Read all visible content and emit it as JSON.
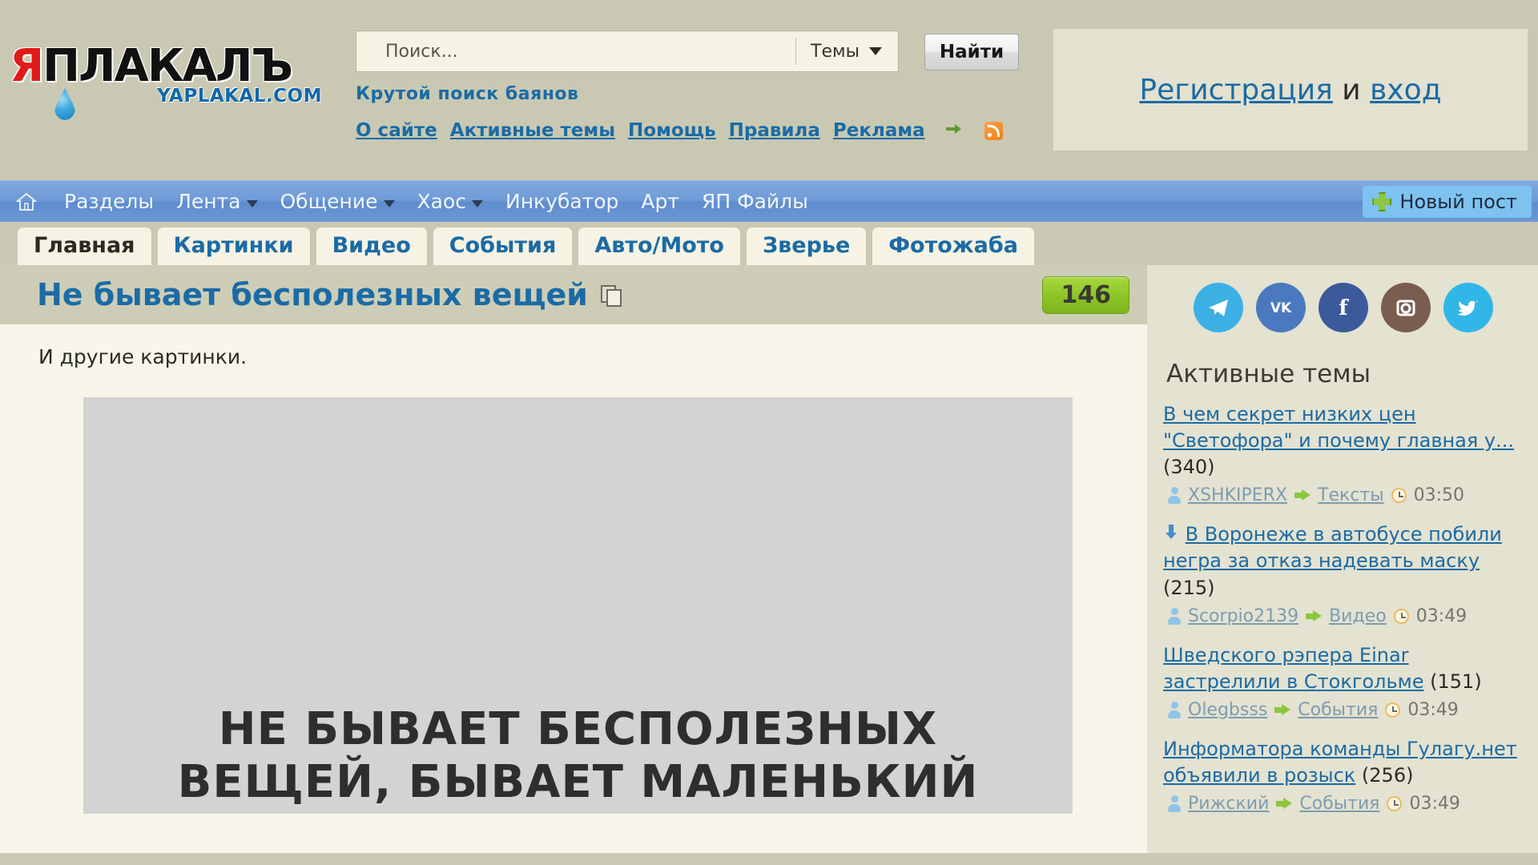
{
  "header": {
    "logo": {
      "first_letter": "Я",
      "rest": "ПЛАКАЛЪ",
      "domain": "YAPLAKAL.COM"
    },
    "search": {
      "placeholder": "Поиск...",
      "value": "",
      "scope_label": "Темы",
      "submit_label": "Найти"
    },
    "tagline": "Крутой поиск баянов",
    "links": [
      {
        "label": "О сайте"
      },
      {
        "label": "Активные темы"
      },
      {
        "label": "Помощь"
      },
      {
        "label": "Правила"
      },
      {
        "label": "Реклама"
      }
    ],
    "auth": {
      "register_label": "Регистрация",
      "conjunction": "и",
      "login_label": "вход"
    }
  },
  "navbar": {
    "items": [
      {
        "label": "Разделы",
        "has_caret": false
      },
      {
        "label": "Лента",
        "has_caret": true
      },
      {
        "label": "Общение",
        "has_caret": true
      },
      {
        "label": "Хаос",
        "has_caret": true
      },
      {
        "label": "Инкубатор",
        "has_caret": false
      },
      {
        "label": "Арт",
        "has_caret": false
      },
      {
        "label": "ЯП Файлы",
        "has_caret": false
      }
    ],
    "new_post_label": "Новый пост"
  },
  "tabs": [
    {
      "label": "Главная",
      "active": true
    },
    {
      "label": "Картинки",
      "active": false
    },
    {
      "label": "Видео",
      "active": false
    },
    {
      "label": "События",
      "active": false
    },
    {
      "label": "Авто/Мото",
      "active": false
    },
    {
      "label": "Зверье",
      "active": false
    },
    {
      "label": "Фотожаба",
      "active": false
    }
  ],
  "post": {
    "title": "Не бывает бесполезных вещей",
    "comment_count": "146",
    "intro_text": "И другие картинки.",
    "image_lines": [
      "НЕ БЫВАЕТ БЕСПОЛЕЗНЫХ",
      "ВЕЩЕЙ, БЫВАЕТ МАЛЕНЬКИЙ"
    ]
  },
  "sidebar": {
    "social": [
      {
        "name": "telegram",
        "color": "#3cb0e5"
      },
      {
        "name": "vk",
        "color": "#4b79c0"
      },
      {
        "name": "facebook",
        "color": "#3c5a9a"
      },
      {
        "name": "instagram",
        "color": "#7a5d4e"
      },
      {
        "name": "twitter",
        "color": "#31b6e8"
      }
    ],
    "active_topics_title": "Активные темы",
    "topics": [
      {
        "pinned": false,
        "title": "В чем секрет низких цен \"Светофора\" и почему главная у...",
        "replies": "(340)",
        "author": "XSHKIPERX",
        "section": "Тексты",
        "time": "03:50"
      },
      {
        "pinned": true,
        "title": "В Воронеже в автобусе побили негра за отказ надевать маску",
        "replies": "(215)",
        "author": "Scorpio2139",
        "section": "Видео",
        "time": "03:49"
      },
      {
        "pinned": false,
        "title": "Шведского рэпера Einar застрелили в Стокгольме",
        "replies": "(151)",
        "author": "Olegbsss",
        "section": "События",
        "time": "03:49"
      },
      {
        "pinned": false,
        "title": "Информатора команды Гулагу.нет объявили в розыск",
        "replies": "(256)",
        "author": "Рижский",
        "section": "События",
        "time": "03:49"
      }
    ]
  }
}
